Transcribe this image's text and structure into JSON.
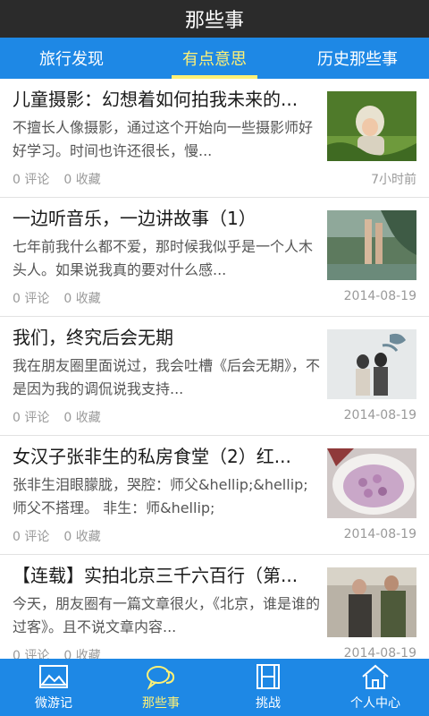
{
  "header": {
    "title": "那些事"
  },
  "tabs": [
    {
      "label": "旅行发现"
    },
    {
      "label": "有点意思"
    },
    {
      "label": "历史那些事"
    }
  ],
  "active_tab": 1,
  "items": [
    {
      "title": "儿童摄影：幻想着如何拍我未来的...",
      "summary": "不擅长人像摄影，通过这个开始向一些摄影师好好学习。时间也许还很长，慢...",
      "comments": "0 评论",
      "favorites": "0 收藏",
      "time": "7小时前",
      "thumb_icon": "photo-child-in-grass"
    },
    {
      "title": "一边听音乐，一边讲故事（1）",
      "summary": "  七年前我什么都不爱，那时候我似乎是一个人木头人。如果说我真的要对什么感...",
      "comments": "0 评论",
      "favorites": "0 收藏",
      "time": "2014-08-19",
      "thumb_icon": "photo-legs-by-water"
    },
    {
      "title": "我们，终究后会无期",
      "summary": " 我在朋友圈里面说过，我会吐槽《后会无期》，不是因为我的调侃说我支持...",
      "comments": "0 评论",
      "favorites": "0 收藏",
      "time": "2014-08-19",
      "thumb_icon": "photo-movie-poster"
    },
    {
      "title": "女汉子张非生的私房食堂（2）红...",
      "summary": "张非生泪眼朦胧，哭腔：师父&hellip;&hellip; 师父不搭理。 非生：师&hellip;",
      "comments": "0 评论",
      "favorites": "0 收藏",
      "time": "2014-08-19",
      "thumb_icon": "photo-food-bowl"
    },
    {
      "title": "【连载】实拍北京三千六百行（第...",
      "summary": "今天，朋友圈有一篇文章很火，《北京，谁是谁的过客》。且不说文章内容...",
      "comments": "0 评论",
      "favorites": "0 收藏",
      "time": "2014-08-19",
      "thumb_icon": "photo-street-people"
    }
  ],
  "bottom_nav": [
    {
      "label": "微游记",
      "icon": "picture-icon"
    },
    {
      "label": "那些事",
      "icon": "chat-bubbles-icon"
    },
    {
      "label": "挑战",
      "icon": "film-icon"
    },
    {
      "label": "个人中心",
      "icon": "home-icon"
    }
  ],
  "active_nav": 1,
  "colors": {
    "titlebar": "#2b2b2b",
    "accent_blue": "#1e88e5",
    "active_yellow": "#fff176"
  }
}
